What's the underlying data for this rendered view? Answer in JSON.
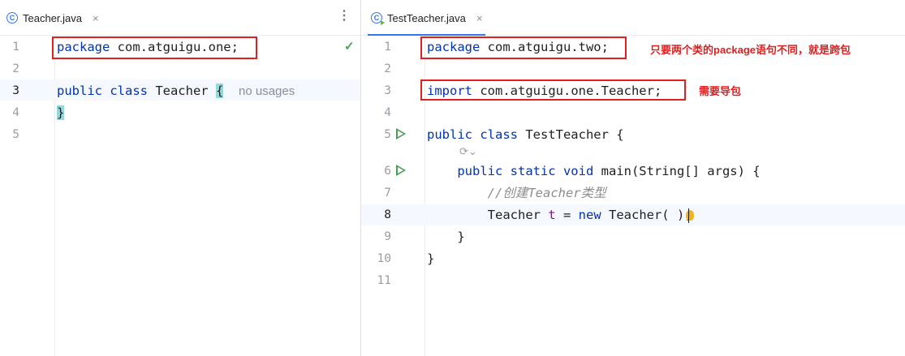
{
  "left_editor": {
    "tab": {
      "icon": "java-class-icon",
      "label": "Teacher.java",
      "close": "×",
      "active": false
    },
    "menu_icon": "⋮",
    "status_icon": "check-icon",
    "lines": [
      {
        "n": "1",
        "text": "package com.atguigu.one;"
      },
      {
        "n": "2",
        "text": ""
      },
      {
        "n": "3",
        "text": "public class Teacher {",
        "hint": "no usages"
      },
      {
        "n": "4",
        "text": "}"
      },
      {
        "n": "5",
        "text": ""
      }
    ]
  },
  "right_editor": {
    "tab": {
      "icon": "java-test-class-icon",
      "label": "TestTeacher.java",
      "close": "×",
      "active": true
    },
    "lines": [
      {
        "n": "1",
        "text": "package com.atguigu.two;"
      },
      {
        "n": "2",
        "text": ""
      },
      {
        "n": "3",
        "text": "import com.atguigu.one.Teacher;"
      },
      {
        "n": "4",
        "text": ""
      },
      {
        "n": "5",
        "text": "public class TestTeacher {",
        "run": true
      },
      {
        "n": "6",
        "text": "public static void main(String[] args) {",
        "run": true
      },
      {
        "n": "7",
        "text": "//创建Teacher类型"
      },
      {
        "n": "8",
        "text": "Teacher t = new Teacher();"
      },
      {
        "n": "9",
        "text": "}"
      },
      {
        "n": "10",
        "text": "}"
      },
      {
        "n": "11",
        "text": ""
      }
    ],
    "inlay_hint_icon": "ai-assistant-icon",
    "notes": {
      "package_note": "只要两个类的package语句不同，就是跨包",
      "import_note": "需要导包"
    }
  },
  "colors": {
    "keyword": "#0033b3",
    "annotation_red": "#e02020",
    "run_green": "#499c54",
    "tab_accent": "#3574f0"
  }
}
